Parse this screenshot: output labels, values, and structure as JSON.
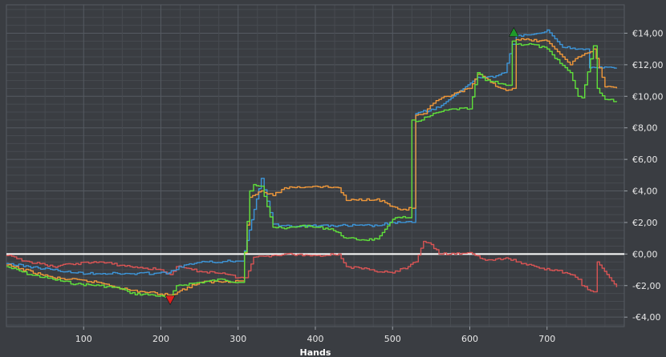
{
  "chart_data": {
    "type": "line",
    "title": "",
    "xlabel": "Hands",
    "ylabel": "",
    "xlim": [
      0,
      800
    ],
    "ylim": [
      -4.6,
      15.8
    ],
    "x_ticks": [
      100,
      200,
      300,
      400,
      500,
      600,
      700
    ],
    "x_tick_labels": [
      "100",
      "200",
      "300",
      "400",
      "500",
      "600",
      "700"
    ],
    "y_ticks": [
      -4,
      -2,
      0,
      2,
      4,
      6,
      8,
      10,
      12,
      14
    ],
    "y_tick_labels": [
      "-€4,00",
      "-€2,00",
      "€0,00",
      "€2,00",
      "€4,00",
      "€6,00",
      "€8,00",
      "€10,00",
      "€12,00",
      "€14,00"
    ],
    "grid": true,
    "zero_line": true,
    "colors": {
      "background": "#3a3d42",
      "grid_minor": "#474b51",
      "grid_major": "#555a61",
      "zero_line": "#ffffff",
      "green": "#5fe03a",
      "orange": "#f0983a",
      "blue": "#3d95d8",
      "red": "#d95454",
      "marker_up": "#1f9a2a",
      "marker_down": "#e01f1f"
    },
    "markers": [
      {
        "type": "max",
        "x": 657,
        "y": 14.1,
        "color": "#1f9a2a"
      },
      {
        "type": "min",
        "x": 212,
        "y": -2.9,
        "color": "#e01f1f"
      }
    ],
    "series": [
      {
        "color": "#5fe03a",
        "x": [
          0,
          30,
          60,
          90,
          120,
          150,
          160,
          190,
          212,
          220,
          250,
          280,
          300,
          305,
          315,
          320,
          330,
          345,
          360,
          380,
          400,
          420,
          440,
          460,
          480,
          500,
          510,
          520,
          525,
          530,
          545,
          560,
          580,
          600,
          610,
          620,
          640,
          650,
          655,
          660,
          680,
          700,
          710,
          730,
          740,
          745,
          760,
          765,
          775,
          790
        ],
        "y": [
          -0.8,
          -1.3,
          -1.6,
          -1.9,
          -2.0,
          -2.2,
          -2.5,
          -2.6,
          -2.8,
          -2.0,
          -1.8,
          -1.6,
          -1.8,
          -1.8,
          4.0,
          4.4,
          4.3,
          1.7,
          1.6,
          1.8,
          1.7,
          1.6,
          1.0,
          0.9,
          0.95,
          2.2,
          2.3,
          2.3,
          8.5,
          8.4,
          8.7,
          9.0,
          9.2,
          9.2,
          11.5,
          11.0,
          10.8,
          10.7,
          13.5,
          13.3,
          13.3,
          13.0,
          12.4,
          11.5,
          10.0,
          9.9,
          13.2,
          10.5,
          9.8,
          9.7
        ]
      },
      {
        "color": "#f0983a",
        "x": [
          0,
          60,
          120,
          160,
          212,
          250,
          300,
          305,
          315,
          330,
          345,
          360,
          400,
          430,
          440,
          480,
          500,
          510,
          525,
          530,
          540,
          545,
          560,
          600,
          610,
          640,
          650,
          655,
          660,
          700,
          730,
          740,
          745,
          760,
          775,
          790
        ],
        "y": [
          -0.7,
          -1.5,
          -1.8,
          -2.3,
          -2.6,
          -1.8,
          -1.7,
          -1.7,
          3.6,
          4.0,
          3.7,
          4.2,
          4.3,
          4.2,
          3.4,
          3.5,
          3.0,
          2.8,
          2.9,
          8.8,
          8.9,
          9.2,
          9.8,
          10.5,
          11.4,
          10.5,
          10.4,
          10.5,
          13.6,
          13.5,
          12.0,
          12.5,
          12.6,
          13.0,
          10.6,
          10.5
        ]
      },
      {
        "color": "#3d95d8",
        "x": [
          0,
          60,
          90,
          160,
          210,
          230,
          260,
          300,
          305,
          330,
          345,
          360,
          480,
          500,
          510,
          525,
          530,
          560,
          610,
          630,
          645,
          655,
          660,
          690,
          700,
          720,
          750,
          755,
          765,
          790
        ],
        "y": [
          -0.6,
          -1.0,
          -1.2,
          -1.25,
          -1.2,
          -0.7,
          -0.5,
          -0.45,
          -0.45,
          4.8,
          1.9,
          1.8,
          1.8,
          2.0,
          2.0,
          2.0,
          8.9,
          9.3,
          11.2,
          11.2,
          11.5,
          13.3,
          13.8,
          14.0,
          14.2,
          13.1,
          13.0,
          11.8,
          11.8,
          11.8
        ]
      },
      {
        "color": "#d95454",
        "x": [
          0,
          30,
          60,
          90,
          120,
          160,
          200,
          212,
          220,
          250,
          280,
          300,
          310,
          320,
          360,
          400,
          430,
          440,
          470,
          500,
          520,
          530,
          540,
          550,
          560,
          580,
          600,
          620,
          650,
          670,
          690,
          710,
          730,
          740,
          745,
          760,
          765,
          790
        ],
        "y": [
          -0.1,
          -0.5,
          -0.8,
          -0.6,
          -0.5,
          -0.8,
          -1.0,
          -1.3,
          -0.8,
          -1.1,
          -1.2,
          -1.5,
          -1.5,
          -0.2,
          0.0,
          -0.1,
          0.0,
          -0.8,
          -1.0,
          -1.2,
          -0.8,
          -0.5,
          0.8,
          0.6,
          0.0,
          0.0,
          0.1,
          -0.4,
          -0.3,
          -0.6,
          -0.9,
          -1.0,
          -1.3,
          -1.6,
          -2.0,
          -2.4,
          -0.5,
          -2.1
        ]
      }
    ]
  }
}
